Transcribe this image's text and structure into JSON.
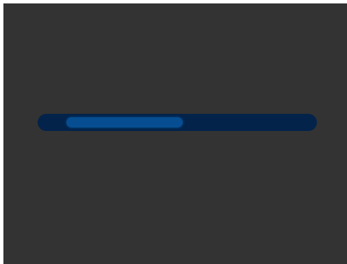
{
  "progress": {
    "indeterminate": true,
    "indicator_start_fraction": 0.103,
    "indicator_end_fraction": 0.52,
    "colors": {
      "background": "#333333",
      "track": "#03234a",
      "indicator": "#064e91"
    }
  }
}
